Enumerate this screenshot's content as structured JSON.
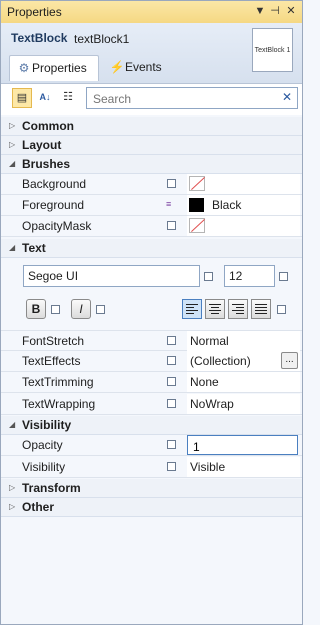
{
  "window": {
    "title": "Properties"
  },
  "header": {
    "type_name": "TextBlock",
    "object_name": "textBlock1",
    "preview_text": "TextBlock 1"
  },
  "tabs": [
    {
      "label": "Properties",
      "icon": "wrench-icon"
    },
    {
      "label": "Events",
      "icon": "lightning-icon"
    }
  ],
  "search": {
    "placeholder": "Search"
  },
  "categories": {
    "common": "Common",
    "layout": "Layout",
    "brushes": "Brushes",
    "text": "Text",
    "visibility": "Visibility",
    "transform": "Transform",
    "other": "Other"
  },
  "brushes": {
    "background": {
      "name": "Background"
    },
    "foreground": {
      "name": "Foreground",
      "value": "Black",
      "color": "#000000"
    },
    "opacity_mask": {
      "name": "OpacityMask"
    }
  },
  "text": {
    "font_family": "Segoe UI",
    "font_size": "12",
    "bold_label": "B",
    "italic_label": "I",
    "font_stretch": {
      "name": "FontStretch",
      "value": "Normal"
    },
    "text_effects": {
      "name": "TextEffects",
      "value": "(Collection)",
      "button": "..."
    },
    "text_trimming": {
      "name": "TextTrimming",
      "value": "None"
    },
    "text_wrapping": {
      "name": "TextWrapping",
      "value": "NoWrap"
    }
  },
  "visibility": {
    "opacity": {
      "name": "Opacity",
      "value": "1"
    },
    "visibility": {
      "name": "Visibility",
      "value": "Visible"
    }
  }
}
